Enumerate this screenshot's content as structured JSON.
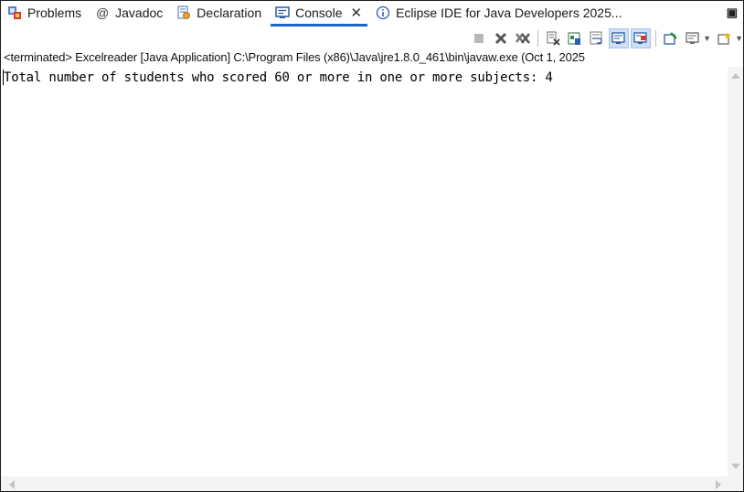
{
  "tabs": [
    {
      "label": "Problems",
      "icon": "problems-icon"
    },
    {
      "label": "Javadoc",
      "icon": "javadoc-at-icon",
      "glyph": "@"
    },
    {
      "label": "Declaration",
      "icon": "declaration-icon"
    },
    {
      "label": "Console",
      "icon": "console-icon",
      "active": true
    },
    {
      "label": "Eclipse IDE for Java Developers 2025...",
      "icon": "info-icon"
    }
  ],
  "toolbar": {
    "icons": [
      "terminate-icon",
      "remove-launch-icon",
      "remove-all-terminated-icon",
      "clear-console-icon",
      "scroll-lock-icon",
      "word-wrap-icon",
      "show-on-stdout-icon",
      "show-on-stderr-icon",
      "pin-console-icon",
      "display-console-icon",
      "open-console-icon"
    ]
  },
  "status_line": "<terminated> Excelreader [Java Application] C:\\Program Files (x86)\\Java\\jre1.8.0_461\\bin\\javaw.exe  (Oct 1, 2025",
  "console": {
    "output": "Total number of students who scored 60 or more in one or more subjects: 4"
  },
  "colors": {
    "active_tab_underline": "#1e63c8",
    "pressed_button": "#cfe0f5"
  }
}
